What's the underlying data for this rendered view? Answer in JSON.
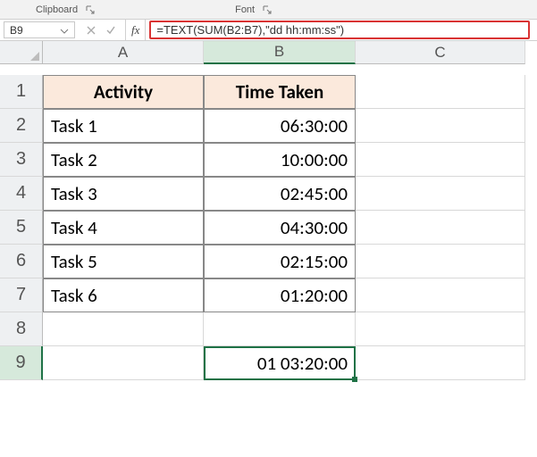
{
  "ribbon": {
    "groups": [
      {
        "label": "Clipboard"
      },
      {
        "label": "Font"
      }
    ]
  },
  "formula_bar": {
    "name_box": "B9",
    "fx_label": "fx",
    "formula": "=TEXT(SUM(B2:B7),\"dd hh:mm:ss\")"
  },
  "columns": [
    "A",
    "B",
    "C"
  ],
  "rows": [
    "1",
    "2",
    "3",
    "4",
    "5",
    "6",
    "7",
    "8",
    "9"
  ],
  "headers": {
    "A": "Activity",
    "B": "Time Taken"
  },
  "data": [
    {
      "activity": "Task 1",
      "time": "06:30:00"
    },
    {
      "activity": "Task 2",
      "time": "10:00:00"
    },
    {
      "activity": "Task 3",
      "time": "02:45:00"
    },
    {
      "activity": "Task 4",
      "time": "04:30:00"
    },
    {
      "activity": "Task 5",
      "time": "02:15:00"
    },
    {
      "activity": "Task 6",
      "time": "01:20:00"
    }
  ],
  "result_cell": "01 03:20:00",
  "active_cell": "B9"
}
